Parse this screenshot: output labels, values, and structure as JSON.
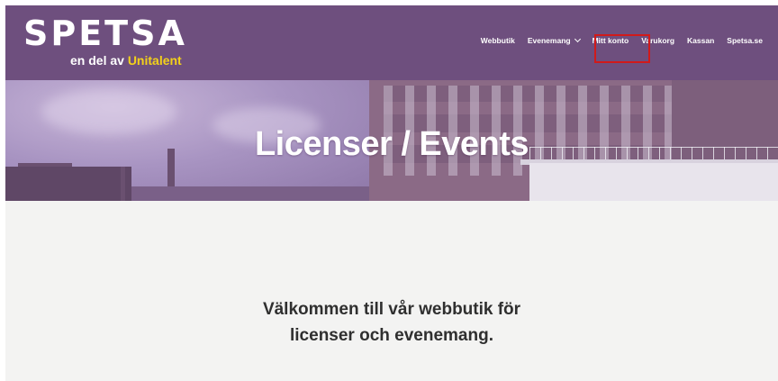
{
  "header": {
    "logo_text": "SPETSA",
    "logo_sub_prefix": "en del av ",
    "logo_sub_brand": "Unitalent",
    "nav": [
      {
        "label": "Webbutik",
        "has_dropdown": false
      },
      {
        "label": "Evenemang",
        "has_dropdown": true
      },
      {
        "label": "Mitt konto",
        "has_dropdown": false,
        "highlighted": true
      },
      {
        "label": "Varukorg",
        "has_dropdown": false
      },
      {
        "label": "Kassan",
        "has_dropdown": false
      },
      {
        "label": "Spetsa.se",
        "has_dropdown": false
      }
    ]
  },
  "hero": {
    "title": "Licenser / Events"
  },
  "content": {
    "welcome_line1": "Välkommen till vår webbutik för",
    "welcome_line2": "licenser och evenemang."
  },
  "colors": {
    "header_bg": "#6e4f7e",
    "brand_accent": "#f3d11a",
    "highlight_box": "#d11a1a",
    "text_dark": "#2f2f2f"
  }
}
